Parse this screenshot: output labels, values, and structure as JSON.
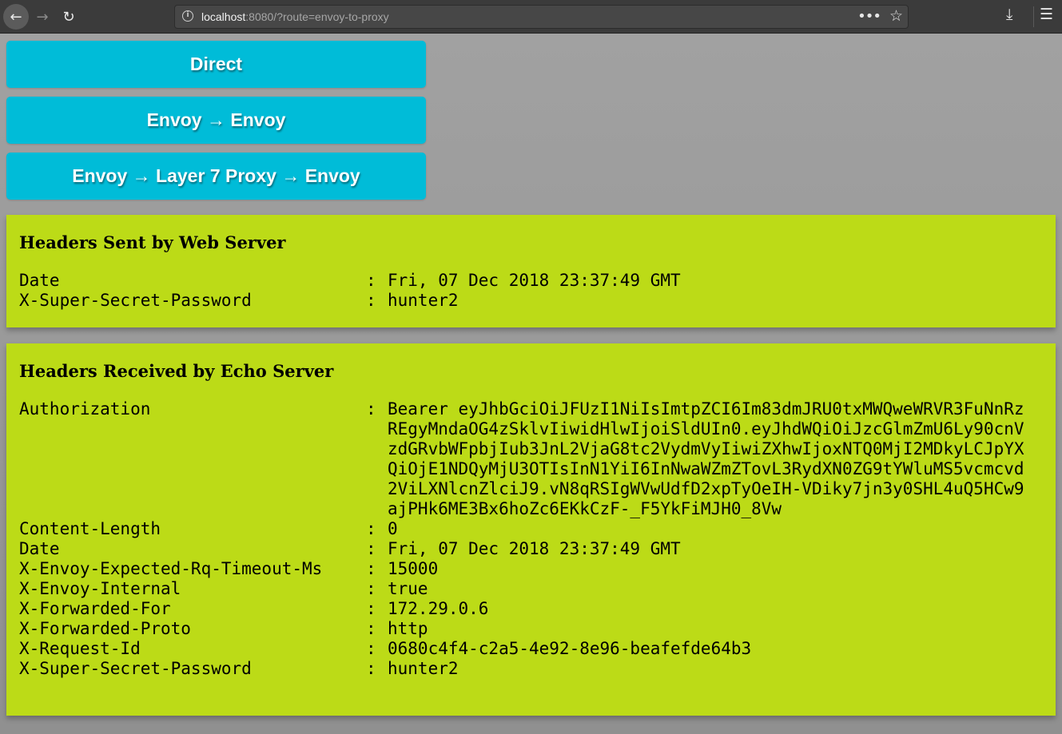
{
  "browser": {
    "url_host": "localhost",
    "url_rest": ":8080/?route=envoy-to-proxy",
    "icons": [
      "back-icon",
      "forward-icon",
      "reload-icon",
      "info-icon",
      "more-icon",
      "star-icon",
      "download-icon",
      "menu-icon"
    ]
  },
  "routes": [
    {
      "label": "Direct"
    },
    {
      "label": "Envoy → Envoy"
    },
    {
      "label": "Envoy → Layer 7 Proxy → Envoy"
    }
  ],
  "colors": {
    "button": "#00bcd8",
    "panel": "#bcdb17"
  },
  "sent": {
    "title": "Headers Sent by Web Server",
    "headers": [
      {
        "name": "Date",
        "sep": ":",
        "value": "Fri, 07 Dec 2018 23:37:49 GMT"
      },
      {
        "name": "X-Super-Secret-Password",
        "sep": ":",
        "value": "hunter2"
      }
    ]
  },
  "received": {
    "title": "Headers Received by Echo Server",
    "headers": [
      {
        "name": "Authorization",
        "sep": ":",
        "value": "Bearer eyJhbGciOiJFUzI1NiIsImtpZCI6Im83dmJRU0txMWQweWRVR3FuNnRzREgyMndaOG4zSklvIiwidHlwIjoiSldUIn0.eyJhdWQiOiJzcGlmZmU6Ly90cnVzdGRvbWFpbjIub3JnL2VjaG8tc2VydmVyIiwiZXhwIjoxNTQ0MjI2MDkyLCJpYXQiOjE1NDQyMjU3OTIsInN1YiI6InNwaWZmZTovL3RydXN0ZG9tYWluMS5vcmcvd2ViLXNlcnZlciJ9.vN8qRSIgWVwUdfD2xpTyOeIH-VDiky7jn3y0SHL4uQ5HCw9ajPHk6ME3Bx6hoZc6EKkCzF-_F5YkFiMJH0_8Vw"
      },
      {
        "name": "Content-Length",
        "sep": ":",
        "value": "0"
      },
      {
        "name": "Date",
        "sep": ":",
        "value": "Fri, 07 Dec 2018 23:37:49 GMT"
      },
      {
        "name": "X-Envoy-Expected-Rq-Timeout-Ms",
        "sep": ":",
        "value": "15000"
      },
      {
        "name": "X-Envoy-Internal",
        "sep": ":",
        "value": "true"
      },
      {
        "name": "X-Forwarded-For",
        "sep": ":",
        "value": "172.29.0.6"
      },
      {
        "name": "X-Forwarded-Proto",
        "sep": ":",
        "value": "http"
      },
      {
        "name": "X-Request-Id",
        "sep": ":",
        "value": "0680c4f4-c2a5-4e92-8e96-beafefde64b3"
      },
      {
        "name": "X-Super-Secret-Password",
        "sep": ":",
        "value": "hunter2"
      }
    ]
  }
}
